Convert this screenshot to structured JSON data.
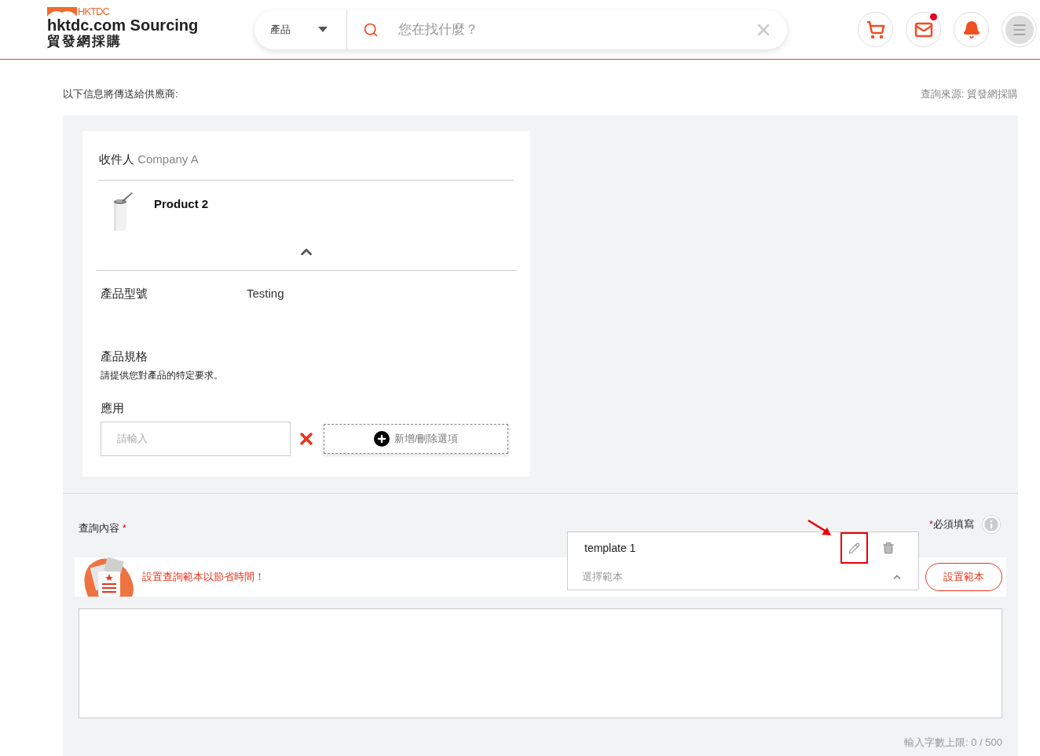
{
  "header": {
    "logo_mark": "HKTDC",
    "title": "hktdc.com Sourcing",
    "subtitle": "貿發網採購",
    "search": {
      "category": "產品",
      "placeholder": "您在找什麼？"
    },
    "icons": [
      {
        "kind": "cart",
        "badge": false
      },
      {
        "kind": "mail",
        "badge": true
      },
      {
        "kind": "bell",
        "badge": false
      },
      {
        "kind": "menu",
        "badge": false
      }
    ]
  },
  "intro": "以下信息將傳送給供應商:",
  "source": "查詢來源: 貿發網採購",
  "card": {
    "recipient_label": "收件人",
    "recipient": "Company A",
    "product": {
      "name": "Product 2",
      "kind": "picture",
      "expanded": true
    },
    "fields": [
      {
        "kind": "value",
        "label": "產品型號",
        "value": "Testing"
      },
      {
        "kind": "heading",
        "label": "產品規格",
        "hint": "請提供您對產品的特定要求。"
      },
      {
        "kind": "input",
        "label": "應用",
        "placeholder": "請輸入",
        "action": "新增/刪除選項"
      }
    ]
  },
  "enquiry": {
    "label": "查詢內容",
    "required_mark": "*",
    "required_note_mark": "*",
    "required_note": "必須填寫",
    "promo": "設置查詢範本以節省時間！",
    "set_template": "設置範本",
    "template_select": {
      "placeholder": "選擇範本",
      "expanded": true,
      "options": [
        {
          "label": "template 1",
          "highlighted": true
        }
      ]
    },
    "counter": "輸入字數上限: 0 / 500"
  }
}
